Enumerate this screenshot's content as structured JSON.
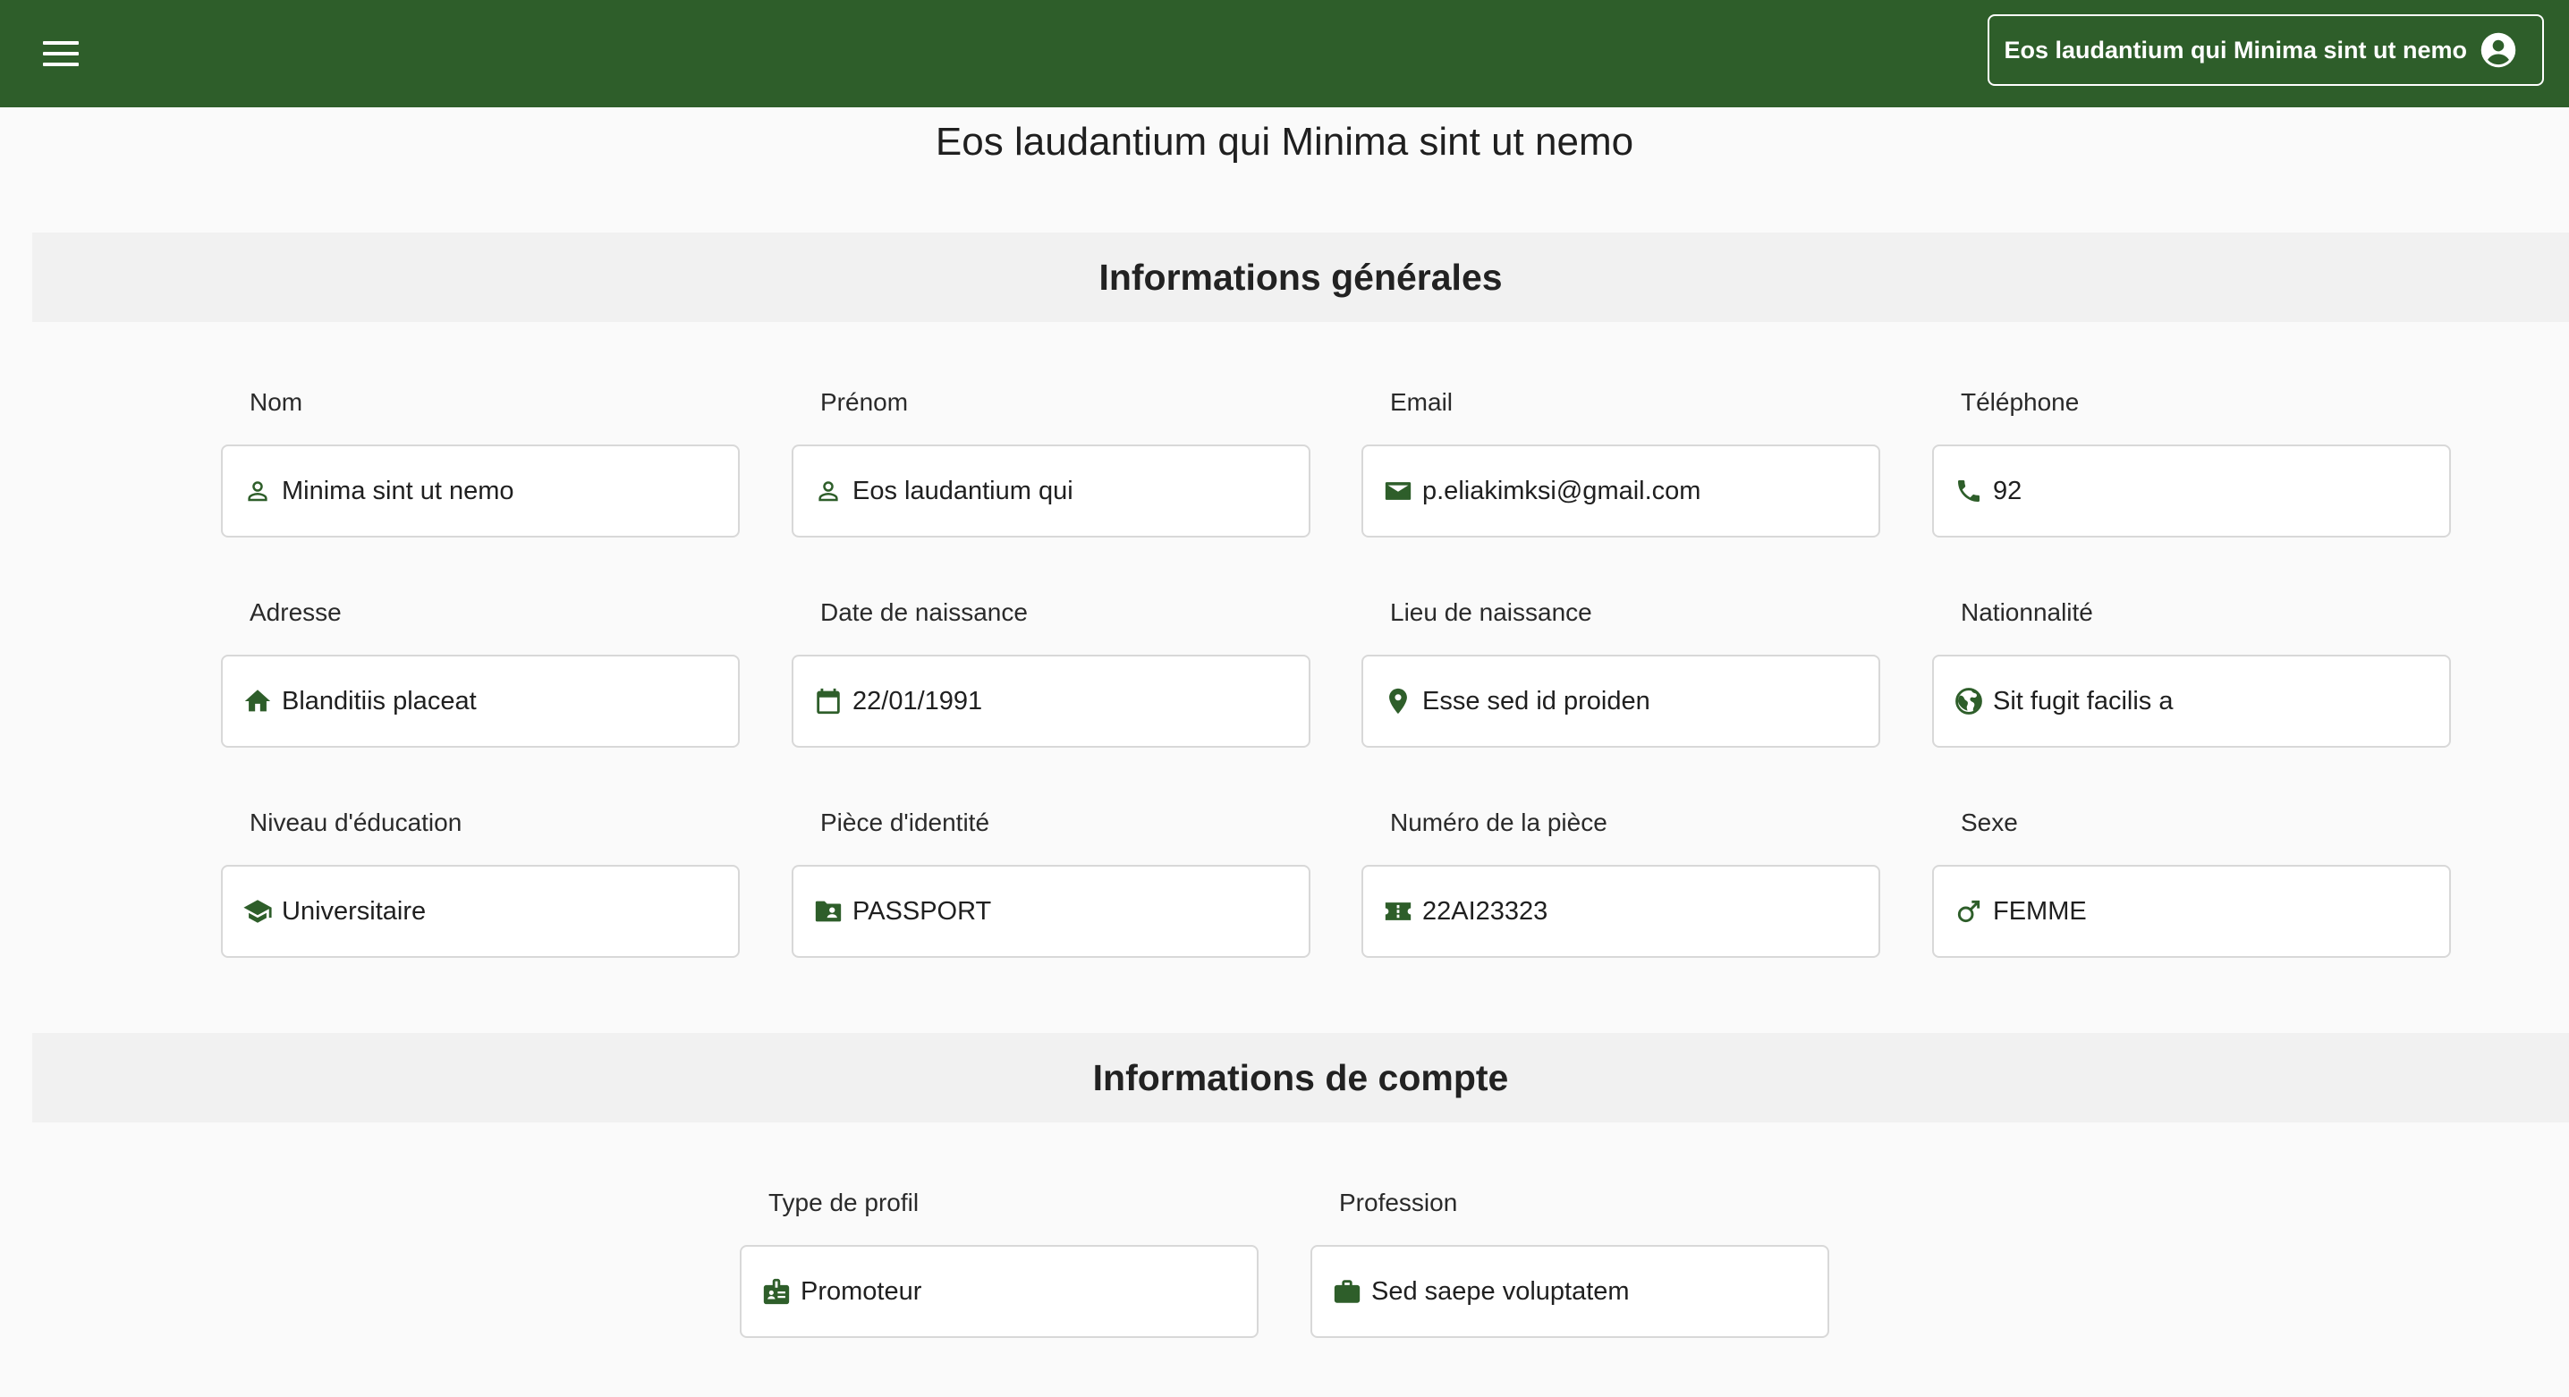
{
  "header": {
    "user_label": "Eos laudantium qui Minima sint ut nemo",
    "user_icon": "account-circle-icon",
    "menu_icon": "hamburger-menu-icon",
    "bar_color": "#2e5e2a"
  },
  "page": {
    "title": "Eos laudantium qui Minima sint ut nemo"
  },
  "general": {
    "heading": "Informations générales",
    "fields": [
      {
        "label": "Nom",
        "value": "Minima sint ut nemo",
        "icon": "person-outline-icon"
      },
      {
        "label": "Prénom",
        "value": "Eos laudantium qui",
        "icon": "person-outline-icon"
      },
      {
        "label": "Email",
        "value": "p.eliakimksi@gmail.com",
        "icon": "mail-icon"
      },
      {
        "label": "Téléphone",
        "value": "92",
        "icon": "phone-icon"
      },
      {
        "label": "Adresse",
        "value": "Blanditiis placeat",
        "icon": "home-icon"
      },
      {
        "label": "Date de naissance",
        "value": "22/01/1991",
        "icon": "calendar-icon"
      },
      {
        "label": "Lieu de naissance",
        "value": "Esse sed id proiden",
        "icon": "location-pin-icon"
      },
      {
        "label": "Nationnalité",
        "value": "Sit fugit facilis a",
        "icon": "globe-icon"
      },
      {
        "label": "Niveau d'éducation",
        "value": "Universitaire",
        "icon": "graduation-cap-icon"
      },
      {
        "label": "Pièce d'identité",
        "value": "PASSPORT",
        "icon": "id-card-icon"
      },
      {
        "label": "Numéro de la pièce",
        "value": "22AI23323",
        "icon": "ticket-icon"
      },
      {
        "label": "Sexe",
        "value": "FEMME",
        "icon": "male-symbol-icon"
      }
    ]
  },
  "account": {
    "heading": "Informations de compte",
    "fields": [
      {
        "label": "Type de profil",
        "value": "Promoteur",
        "icon": "badge-icon"
      },
      {
        "label": "Profession",
        "value": "Sed saepe voluptatem",
        "icon": "briefcase-icon"
      }
    ]
  },
  "colors": {
    "accent": "#2e5e2a",
    "field_border": "#d8d8d8",
    "section_bg": "#f1f1f1",
    "page_bg": "#fafafa"
  }
}
